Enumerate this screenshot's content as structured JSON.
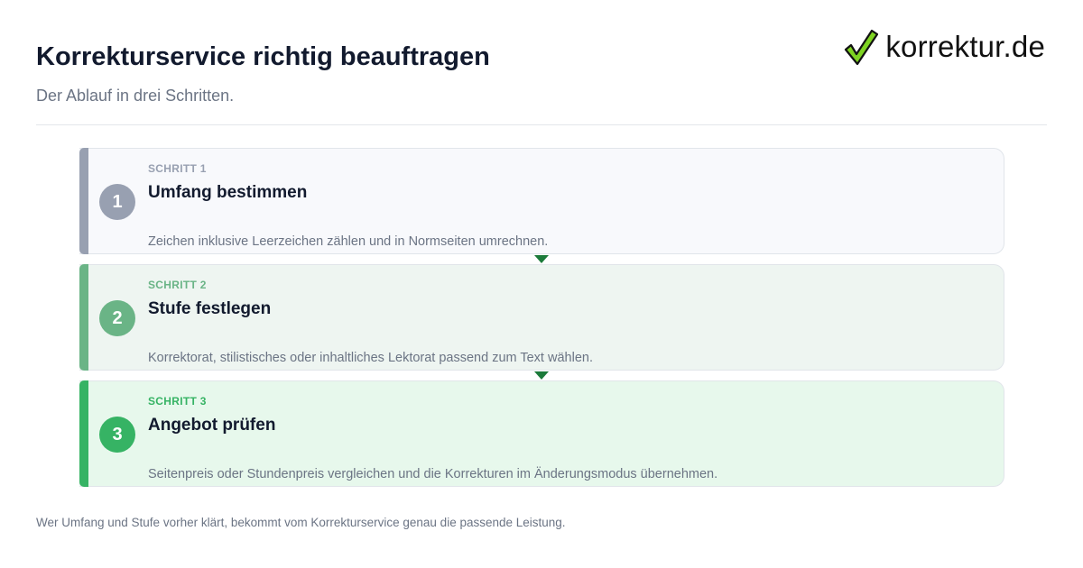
{
  "header": {
    "title": "Korrekturservice richtig beauftragen",
    "subtitle": "Der Ablauf in drei Schritten."
  },
  "logo": {
    "text": "korrektur.de",
    "icon": "checkmark-icon",
    "icon_color": "#7ed321"
  },
  "steps": [
    {
      "number": "1",
      "label": "SCHRITT 1",
      "heading": "Umfang bestimmen",
      "description": "Zeichen inklusive Leerzeichen zählen und in Normseiten umrechnen.",
      "color": "#98a0b1"
    },
    {
      "number": "2",
      "label": "SCHRITT 2",
      "heading": "Stufe festlegen",
      "description": "Korrektorat, stilistisches oder inhaltliches Lektorat passend zum Text wählen.",
      "color": "#6ab486"
    },
    {
      "number": "3",
      "label": "SCHRITT 3",
      "heading": "Angebot prüfen",
      "description": "Seitenpreis oder Stundenpreis vergleichen und die Korrekturen im Änderungsmodus übernehmen.",
      "color": "#36b364"
    }
  ],
  "footer": {
    "text": "Wer Umfang und Stufe vorher klärt, bekommt vom Korrekturservice genau die passende Leistung."
  }
}
